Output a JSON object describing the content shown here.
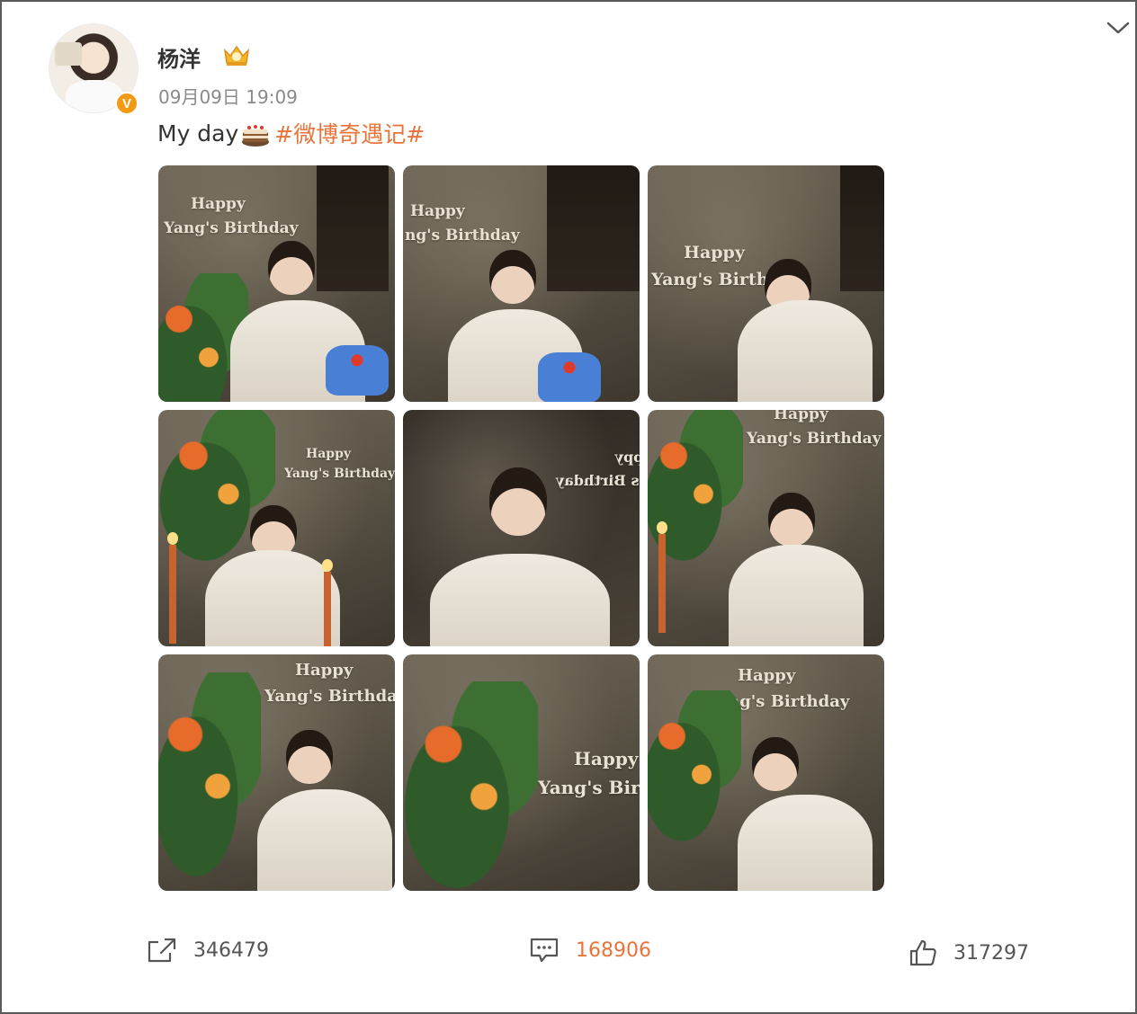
{
  "post": {
    "username": "杨洋",
    "timestamp": "09月09日 19:09",
    "text": "My day",
    "hashtag": "#微博奇遇记#",
    "verified_mark": "V"
  },
  "photos": [
    {
      "lines": [
        "Happy",
        "Yang's Birthday"
      ]
    },
    {
      "lines": [
        "Happy",
        "ng's Birthday"
      ]
    },
    {
      "lines": [
        "Happy",
        "Yang's Birtha"
      ]
    },
    {
      "lines": [
        "Happy",
        "Yang's Birthday"
      ]
    },
    {
      "lines": [
        "ppy",
        "'s Birthday"
      ]
    },
    {
      "lines": [
        "Happy",
        "Yang's Birthday"
      ]
    },
    {
      "lines": [
        "Happy",
        "Yang's Birthday"
      ]
    },
    {
      "lines": [
        "Happy",
        "Yang's Birt"
      ]
    },
    {
      "lines": [
        "Happy",
        "Yang's Birthday"
      ]
    }
  ],
  "actions": {
    "repost_count": "346479",
    "comment_count": "168906",
    "like_count": "317297"
  },
  "colors": {
    "hashtag": "#e8743b",
    "verified_bg": "#f29a12",
    "border": "#5a5a5a"
  },
  "icons": [
    "chevron-down-icon",
    "vip-badge-icon",
    "cake-emoji-icon",
    "share-icon",
    "comment-icon",
    "thumbs-up-icon",
    "verified-icon"
  ]
}
